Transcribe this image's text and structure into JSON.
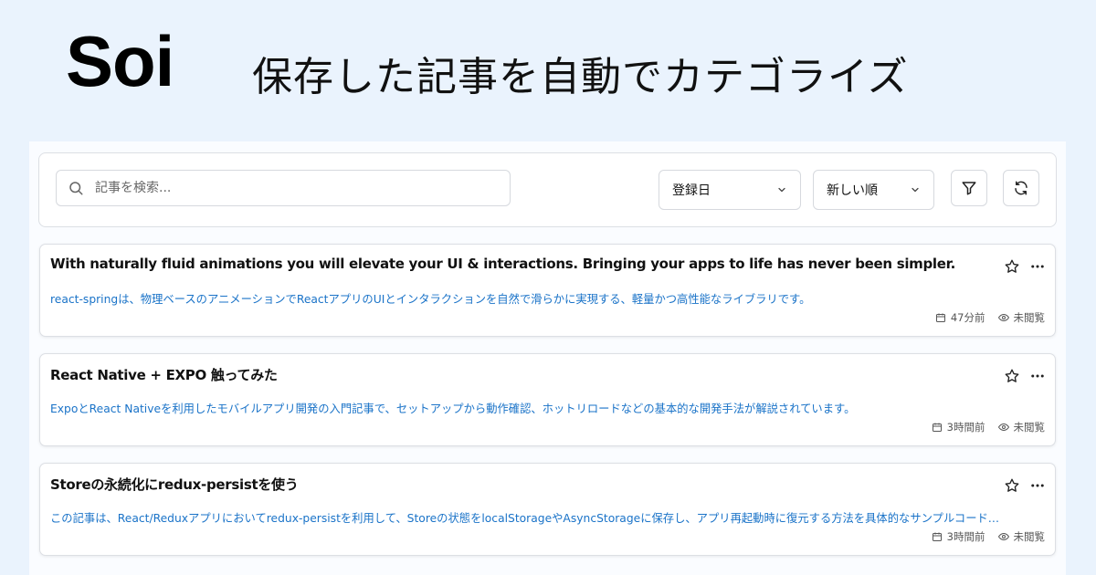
{
  "header": {
    "logo": "Soi",
    "tagline": "保存した記事を自動でカテゴライズ"
  },
  "toolbar": {
    "search_placeholder": "記事を検索...",
    "search_value": "",
    "sort_field": "登録日",
    "sort_order": "新しい順",
    "filter_icon": "filter-icon",
    "refresh_icon": "refresh-icon"
  },
  "articles": [
    {
      "title": "With naturally fluid animations you will elevate your UI & interactions. Bringing your apps to life has never been simpler.",
      "summary": "react-springは、物理ベースのアニメーションでReactアプリのUIとインタラクションを自然で滑らかに実現する、軽量かつ高性能なライブラリです。",
      "time": "47分前",
      "status": "未閲覧"
    },
    {
      "title": "React Native + EXPO 触ってみた",
      "summary": "ExpoとReact Nativeを利用したモバイルアプリ開発の入門記事で、セットアップから動作確認、ホットリロードなどの基本的な開発手法が解説されています。",
      "time": "3時間前",
      "status": "未閲覧"
    },
    {
      "title": "Storeの永続化にredux-persistを使う",
      "summary": "この記事は、React/Reduxアプリにおいてredux-persistを利用して、Storeの状態をlocalStorageやAsyncStorageに保存し、アプリ再起動時に復元する方法を具体的なサンプルコード…",
      "time": "3時間前",
      "status": "未閲覧"
    }
  ],
  "colors": {
    "background": "#eaf3fd",
    "summary_link": "#1a73c8",
    "border": "#dcdfe4"
  }
}
